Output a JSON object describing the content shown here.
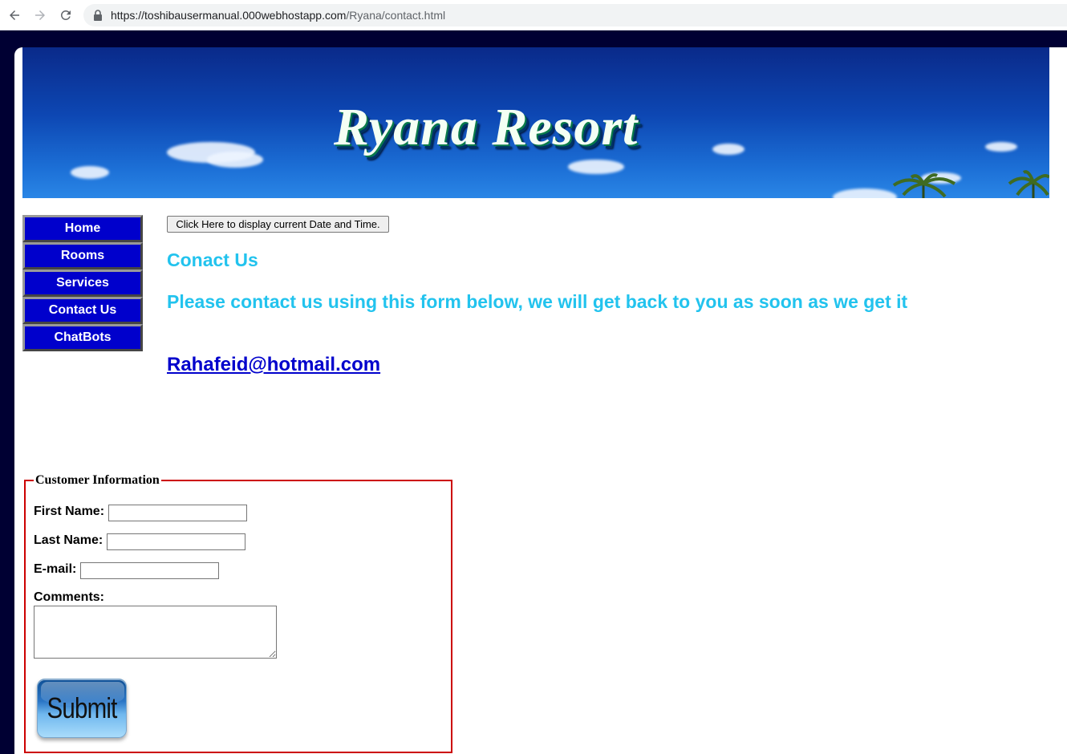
{
  "browser": {
    "url_host": "https://toshibausermanual.000webhostapp.com",
    "url_path": "/Ryana/contact.html"
  },
  "banner": {
    "title": "Ryana Resort"
  },
  "nav": {
    "items": [
      {
        "label": "Home"
      },
      {
        "label": "Rooms"
      },
      {
        "label": "Services"
      },
      {
        "label": "Contact Us"
      },
      {
        "label": "ChatBots"
      }
    ]
  },
  "main": {
    "datetime_button": "Click Here to display current Date and Time.",
    "heading": "Conact Us",
    "subheading": "Please contact us using this form below, we will get back to you as soon as we get it",
    "email": "Rahafeid@hotmail.com"
  },
  "form": {
    "legend": "Customer Information",
    "first_name_label": "First Name:",
    "first_name_value": "",
    "last_name_label": "Last Name:",
    "last_name_value": "",
    "email_label": "E-mail:",
    "email_value": "",
    "comments_label": "Comments:",
    "comments_value": "",
    "submit_label": "Submit"
  },
  "colors": {
    "page_frame": "#000033",
    "nav_bg": "#0000cc",
    "heading": "#22c3ee",
    "link": "#0000cc",
    "fieldset_border": "#cc0000"
  },
  "icons": [
    "back-arrow-icon",
    "forward-arrow-icon",
    "reload-icon",
    "lock-icon",
    "palm-tree-icon"
  ]
}
